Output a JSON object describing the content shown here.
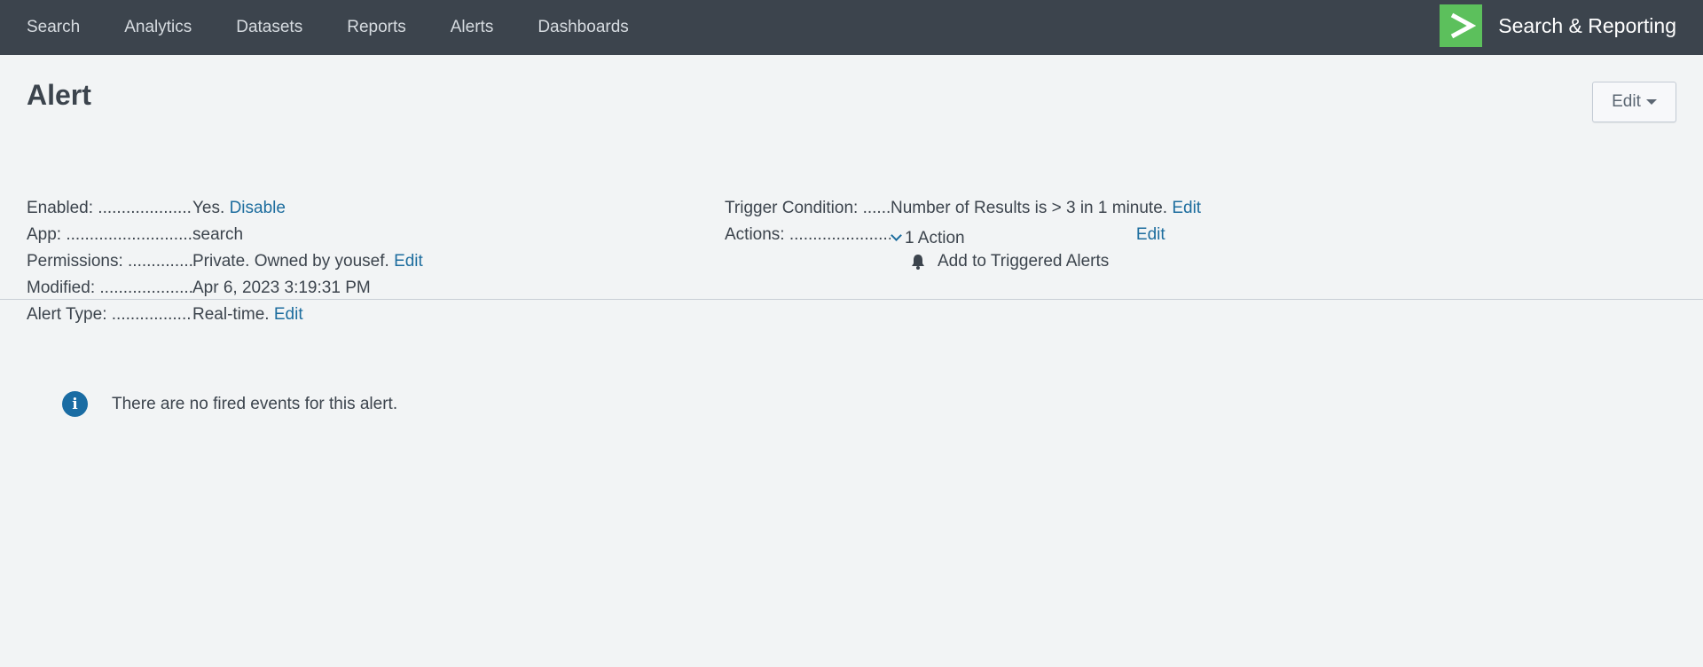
{
  "nav": {
    "items": [
      "Search",
      "Analytics",
      "Datasets",
      "Reports",
      "Alerts",
      "Dashboards"
    ],
    "brand_name": "Search & Reporting",
    "brand_logo_icon": "chevron-right-icon",
    "brand_color": "#5cc05c"
  },
  "page": {
    "title": "Alert",
    "edit_label": "Edit"
  },
  "details": {
    "enabled_label": "Enabled:",
    "enabled_value": "Yes.",
    "enabled_action": "Disable",
    "app_label": "App:",
    "app_value": "search",
    "permissions_label": "Permissions:",
    "permissions_value": "Private. Owned by yousef.",
    "permissions_action": "Edit",
    "modified_label": "Modified:",
    "modified_value": "Apr 6, 2023 3:19:31 PM",
    "alert_type_label": "Alert Type:",
    "alert_type_value": "Real-time.",
    "alert_type_action": "Edit",
    "trigger_label": "Trigger Condition:",
    "trigger_value": "Number of Results is > 3 in 1 minute.",
    "trigger_action": "Edit",
    "actions_label": "Actions:",
    "actions_value": "1 Action",
    "actions_edit": "Edit",
    "action_item": "Add to Triggered Alerts",
    "action_item_icon": "bell-icon"
  },
  "empty_state": {
    "icon": "info-icon",
    "message": "There are no fired events for this alert."
  },
  "colors": {
    "nav_bg": "#3c444d",
    "page_bg": "#f2f4f5",
    "link": "#1d6d9e",
    "info": "#1a6ca3"
  }
}
